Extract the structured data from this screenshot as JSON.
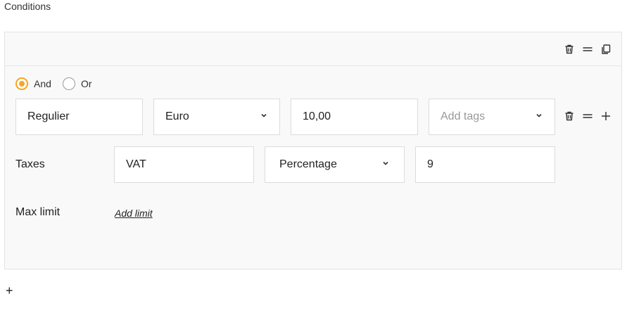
{
  "header": {
    "title": "Conditions"
  },
  "card": {
    "header_icons": [
      "trash-icon",
      "drag-handle-icon",
      "copy-icon"
    ],
    "logic": {
      "options": [
        "And",
        "Or"
      ],
      "selected": "And"
    },
    "row": {
      "name_value": "Regulier",
      "currency_value": "Euro",
      "amount_value": "10,00",
      "tags_placeholder": "Add tags",
      "row_icons": [
        "trash-icon",
        "drag-handle-icon",
        "plus-icon"
      ]
    },
    "taxes": {
      "label": "Taxes",
      "name_value": "VAT",
      "type_value": "Percentage",
      "amount_value": "9"
    },
    "max_limit": {
      "label": "Max limit",
      "link_label": "Add limit"
    }
  },
  "footer": {
    "add_label": "+"
  },
  "colors": {
    "accent": "#f5a623",
    "border": "#dcdcdc",
    "card_bg": "#f9f9f9"
  }
}
